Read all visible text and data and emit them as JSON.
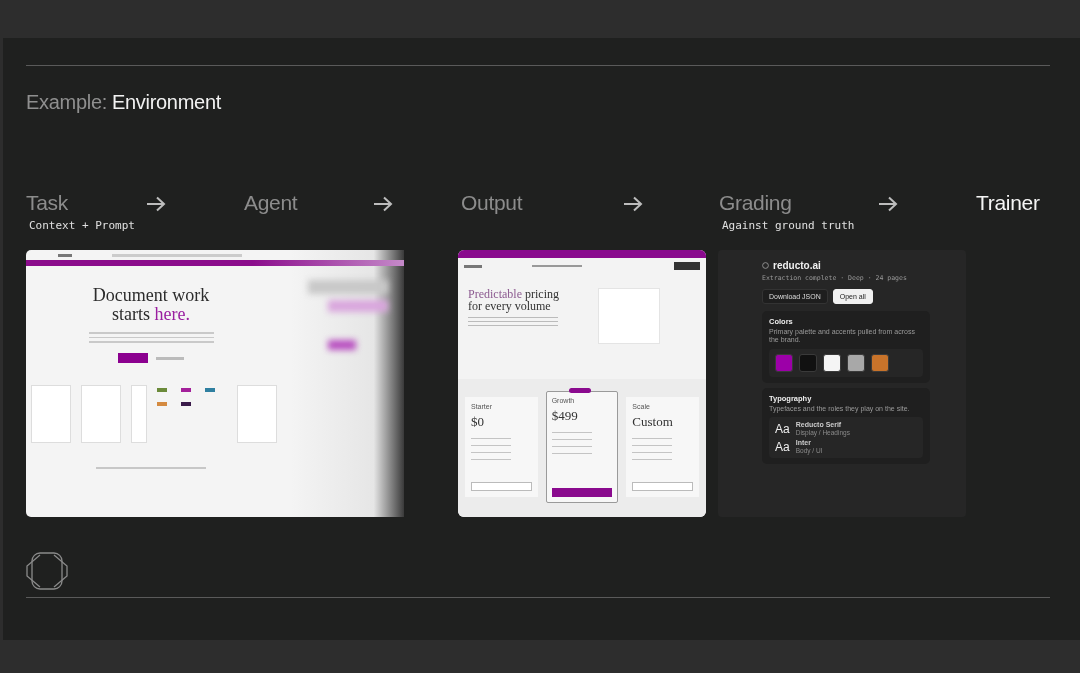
{
  "heading": {
    "prefix": "Example:",
    "title": "Environment"
  },
  "steps": [
    {
      "label": "Task",
      "caption": "Context + Prompt",
      "highlighted": false
    },
    {
      "label": "Agent",
      "highlighted": false
    },
    {
      "label": "Output",
      "highlighted": false
    },
    {
      "label": "Grading",
      "caption": "Against ground truth",
      "highlighted": false
    },
    {
      "label": "Trainer",
      "highlighted": true
    }
  ],
  "task_screenshot": {
    "headline": "Document work starts",
    "headline_accent": "here."
  },
  "output_screenshot": {
    "headline_accent": "Predictable",
    "headline": "pricing for every volume",
    "plans": [
      {
        "name": "Starter",
        "price": "$0",
        "featured": false
      },
      {
        "name": "Growth",
        "price": "$499",
        "featured": true
      },
      {
        "name": "Scale",
        "price": "Custom",
        "featured": false
      }
    ]
  },
  "grading_panel": {
    "site": "reducto.ai",
    "status": "Extraction complete · Deep · 24 pages",
    "buttons": [
      {
        "label": "Download JSON",
        "primary": false
      },
      {
        "label": "Open all",
        "primary": true
      }
    ],
    "colors": {
      "title": "Colors",
      "description": "Primary palette and accents pulled from across the brand.",
      "swatches": [
        {
          "color": "#9c00a8"
        },
        {
          "color": "#111111"
        },
        {
          "color": "#f5f5f5"
        },
        {
          "color": "#a8a8a8"
        },
        {
          "color": "#c8732a"
        }
      ]
    },
    "typography": {
      "title": "Typography",
      "description": "Typefaces and the roles they play on the site.",
      "fonts": [
        {
          "sample": "Aa",
          "name": "Reducto Serif",
          "role": "Display / Headings"
        },
        {
          "sample": "Aa",
          "name": "Inter",
          "role": "Body / UI"
        }
      ]
    }
  }
}
